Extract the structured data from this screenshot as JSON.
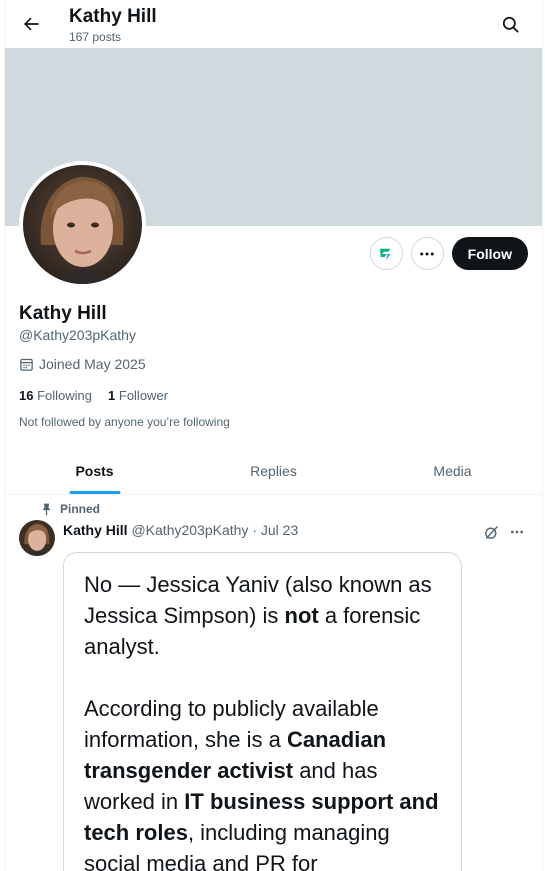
{
  "header": {
    "name": "Kathy Hill",
    "posts_count": "167 posts"
  },
  "colors": {
    "banner": "#cfd9de",
    "accent": "#1d9bf0",
    "follow_bg": "#0f1419",
    "verified": "#00ba7c"
  },
  "profile": {
    "display_name": "Kathy Hill",
    "handle": "@Kathy203pKathy",
    "joined": "Joined May 2025",
    "following_count": "16",
    "following_label": "Following",
    "followers_count": "1",
    "followers_label": "Follower",
    "not_followed": "Not followed by anyone you’re following",
    "follow_label": "Follow"
  },
  "tabs": [
    {
      "label": "Posts"
    },
    {
      "label": "Replies"
    },
    {
      "label": "Media"
    }
  ],
  "post": {
    "pinned_label": "Pinned",
    "author": "Kathy Hill",
    "meta": "@Kathy203pKathy · Jul 23",
    "image_text": {
      "p1_a": "No — Jessica Yaniv (also known as Jessica Simpson) is ",
      "p1_b": "not",
      "p1_c": " a forensic analyst.",
      "p2_a": "According to publicly available information, she is a ",
      "p2_b": "Canadian transgender activist",
      "p2_c": " and has worked in ",
      "p2_d": "IT business support and tech roles",
      "p2_e": ", including managing social media and PR for"
    }
  },
  "icons": [
    "back-arrow-icon",
    "search-icon",
    "grok-icon",
    "more-icon",
    "calendar-icon",
    "pin-icon"
  ]
}
